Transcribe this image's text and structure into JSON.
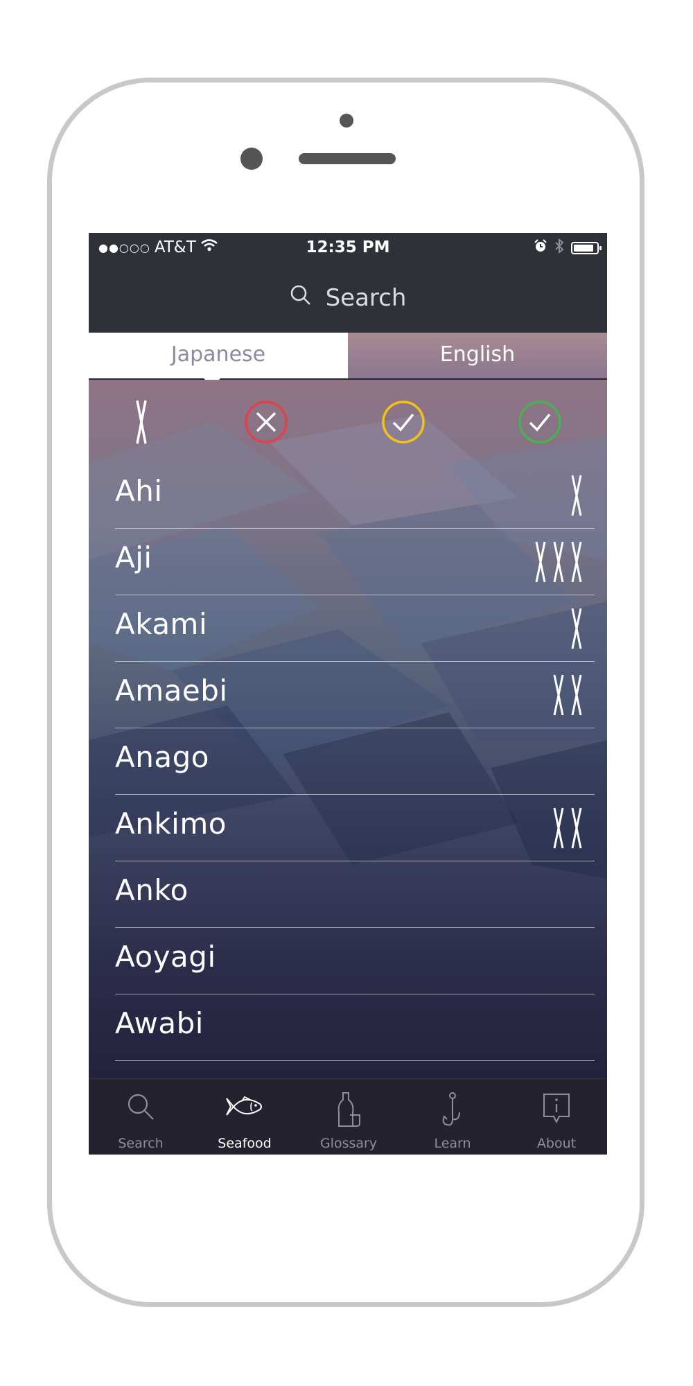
{
  "status_bar": {
    "signal": "●●○○○",
    "carrier": "AT&T",
    "time": "12:35 PM"
  },
  "search": {
    "placeholder": "Search"
  },
  "segments": {
    "japanese": "Japanese",
    "english": "English",
    "selected": "Japanese"
  },
  "filters": [
    {
      "name": "chopsticks-filter",
      "icon": "chopsticks-icon"
    },
    {
      "name": "not-tried-filter",
      "icon": "x-circle-icon",
      "color": "#e0414b"
    },
    {
      "name": "tried-filter",
      "icon": "check-circle-icon",
      "color": "#f2c21b"
    },
    {
      "name": "liked-filter",
      "icon": "check-circle-icon",
      "color": "#4caf50"
    }
  ],
  "seafood_list": [
    {
      "name": "Ahi",
      "rating": 1
    },
    {
      "name": "Aji",
      "rating": 3
    },
    {
      "name": "Akami",
      "rating": 1
    },
    {
      "name": "Amaebi",
      "rating": 2
    },
    {
      "name": "Anago",
      "rating": 0
    },
    {
      "name": "Ankimo",
      "rating": 2
    },
    {
      "name": "Anko",
      "rating": 0
    },
    {
      "name": "Aoyagi",
      "rating": 0
    },
    {
      "name": "Awabi",
      "rating": 0
    }
  ],
  "tab_bar": [
    {
      "label": "Search",
      "icon": "search-icon",
      "active": false
    },
    {
      "label": "Seafood",
      "icon": "fish-icon",
      "active": true
    },
    {
      "label": "Glossary",
      "icon": "sake-bottle-icon",
      "active": false
    },
    {
      "label": "Learn",
      "icon": "fish-hook-icon",
      "active": false
    },
    {
      "label": "About",
      "icon": "info-bubble-icon",
      "active": false
    }
  ]
}
